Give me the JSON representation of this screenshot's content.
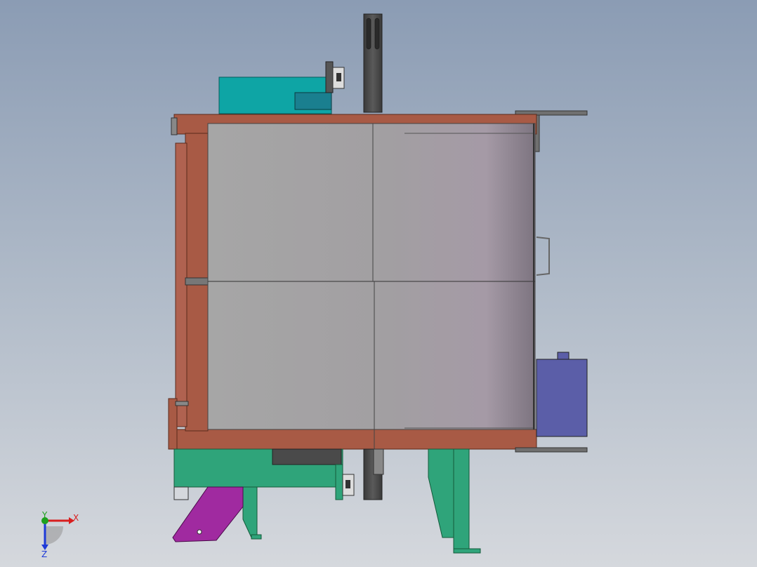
{
  "viewport": {
    "background_top": "#8b9cb4",
    "background_bottom": "#d5d8dd"
  },
  "colors": {
    "frame": "#a85a45",
    "frame_edge": "#7a3a2a",
    "panel": "#a8a8a8",
    "panel_dark": "#8e8690",
    "cyan_box": "#0ea5a5",
    "teal_block": "#1a7f8f",
    "shaft": "#4a4a4a",
    "green_base": "#2fa47a",
    "purple_bracket": "#a02aa0",
    "motor_box": "#5b5ea8",
    "bracket_grey": "#707070"
  },
  "triad": {
    "x_label": "X",
    "y_label": "Y",
    "z_label": "Z"
  }
}
